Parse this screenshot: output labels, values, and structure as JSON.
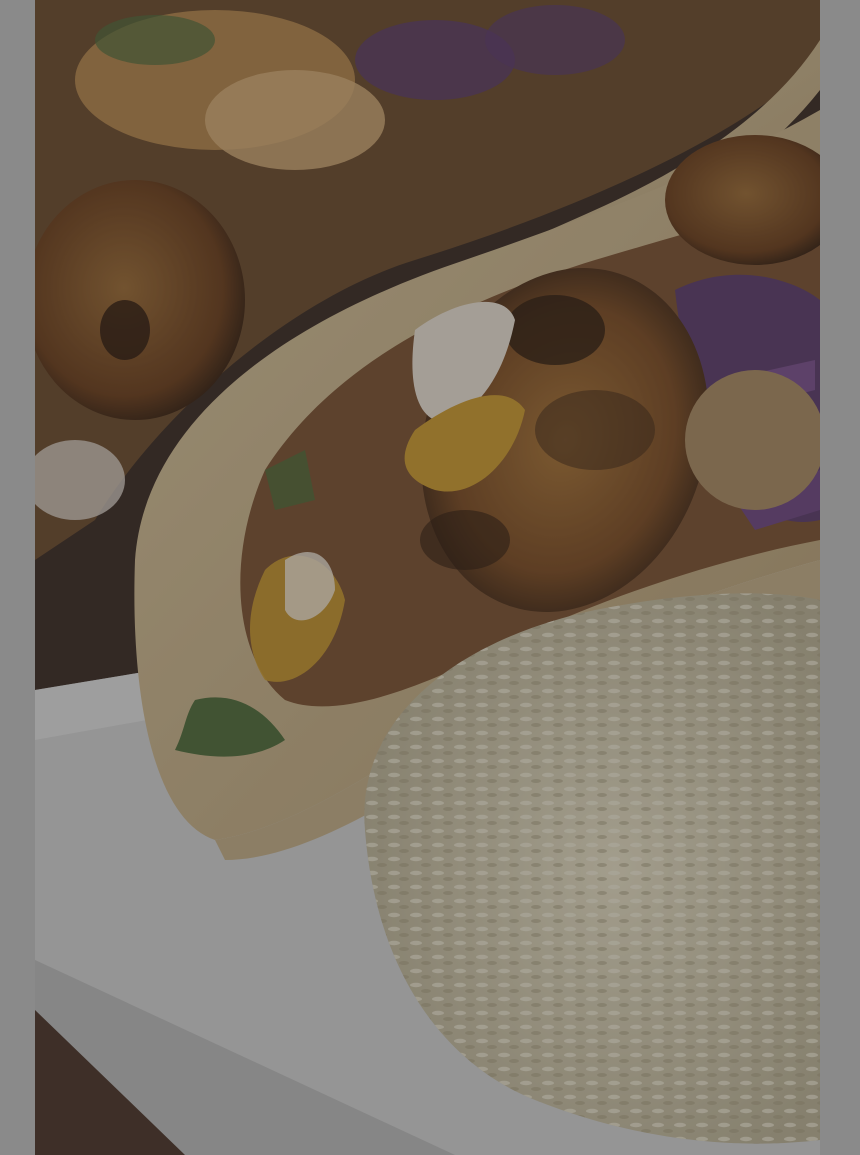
{
  "photo": {
    "subject": "food-photo",
    "colors": {
      "side_margin": "#8a8a8a",
      "wood_table": "#3a2a22",
      "plate": "#cfcfcf",
      "tortilla": "#c9b48f",
      "fish": "#8a5a2e",
      "fish_char": "#3b2414",
      "cabbage": "#5b3b6b",
      "rice": "#d6cfb5",
      "sauce": "#c9982e",
      "cilantro": "#4f6b3a"
    }
  }
}
